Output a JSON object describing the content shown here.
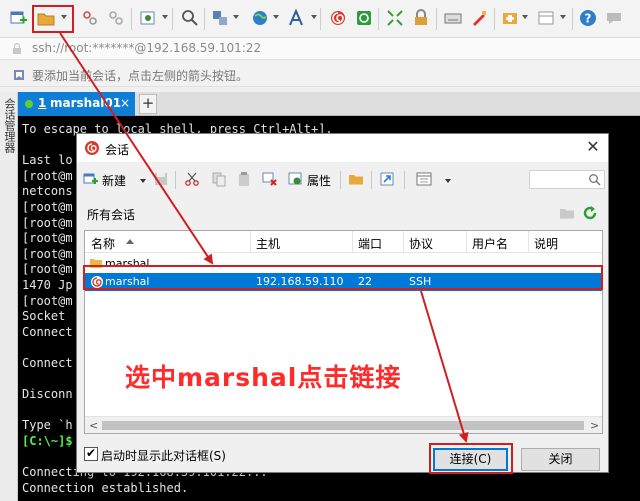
{
  "toolbar": {
    "icons": [
      "new-session-icon",
      "open-session-folder-icon",
      "reconnect-icon",
      "disconnect-icon",
      "properties-icon",
      "find-icon",
      "transfer-icon",
      "globe-icon",
      "font-icon",
      "xftp-icon",
      "xshell-swirl-icon",
      "fullscreen-icon",
      "lock-icon",
      "keyboard-icon",
      "highlight-icon",
      "new-tab-icon",
      "layout-icon",
      "help-icon",
      "chat-icon"
    ]
  },
  "address": {
    "text": "ssh://root:*******@192.168.59.101:22"
  },
  "hint": {
    "text": "要添加当前会话，点击左侧的箭头按钮。"
  },
  "sidebar": {
    "label": "会话管理器"
  },
  "tab": {
    "number": "1",
    "name": "marshal01",
    "close": "×",
    "add": "+"
  },
  "terminal": {
    "lines": [
      "To escape to local shell, press Ctrl+Alt+].",
      "",
      "Last lo",
      "[root@m",
      "netcons",
      "[root@m",
      "[root@m",
      "[root@m",
      "[root@m",
      "[root@m",
      "1470 Jp",
      "[root@m",
      "Socket",
      "Connect",
      "",
      "Connect",
      "",
      "Disconn",
      "",
      "Type `h",
      "[C:\\~]$",
      "",
      "Connecting to 192.168.59.101:22...",
      "Connection established."
    ]
  },
  "dialog": {
    "title": "会话",
    "close": "✕",
    "toolbar": {
      "new_label": "新建",
      "properties_label": "属性"
    },
    "path": "所有会话",
    "columns": [
      "名称",
      "主机",
      "端口",
      "协议",
      "用户名",
      "说明"
    ],
    "rows": [
      {
        "type": "folder",
        "name": "marshal",
        "host": "",
        "port": "",
        "protocol": "",
        "user": "",
        "desc": "",
        "selected": false
      },
      {
        "type": "session",
        "name": "marshal",
        "host": "192.168.59.110",
        "port": "22",
        "protocol": "SSH",
        "user": "",
        "desc": "",
        "selected": true
      }
    ],
    "scroll_left": "<",
    "scroll_right": ">",
    "startup_checkbox": {
      "checked": true,
      "label": "启动时显示此对话框(S)"
    },
    "connect_button": "连接(C)",
    "close_button": "关闭"
  },
  "annotation": {
    "text": "选中marshal点击链接",
    "color": "#ff2a2a"
  },
  "colors": {
    "accent": "#0078d7",
    "tab": "#0f7fd5",
    "annotation": "#d11f1f",
    "terminal_bg": "#000000",
    "prompt_green": "#4ef04e"
  }
}
